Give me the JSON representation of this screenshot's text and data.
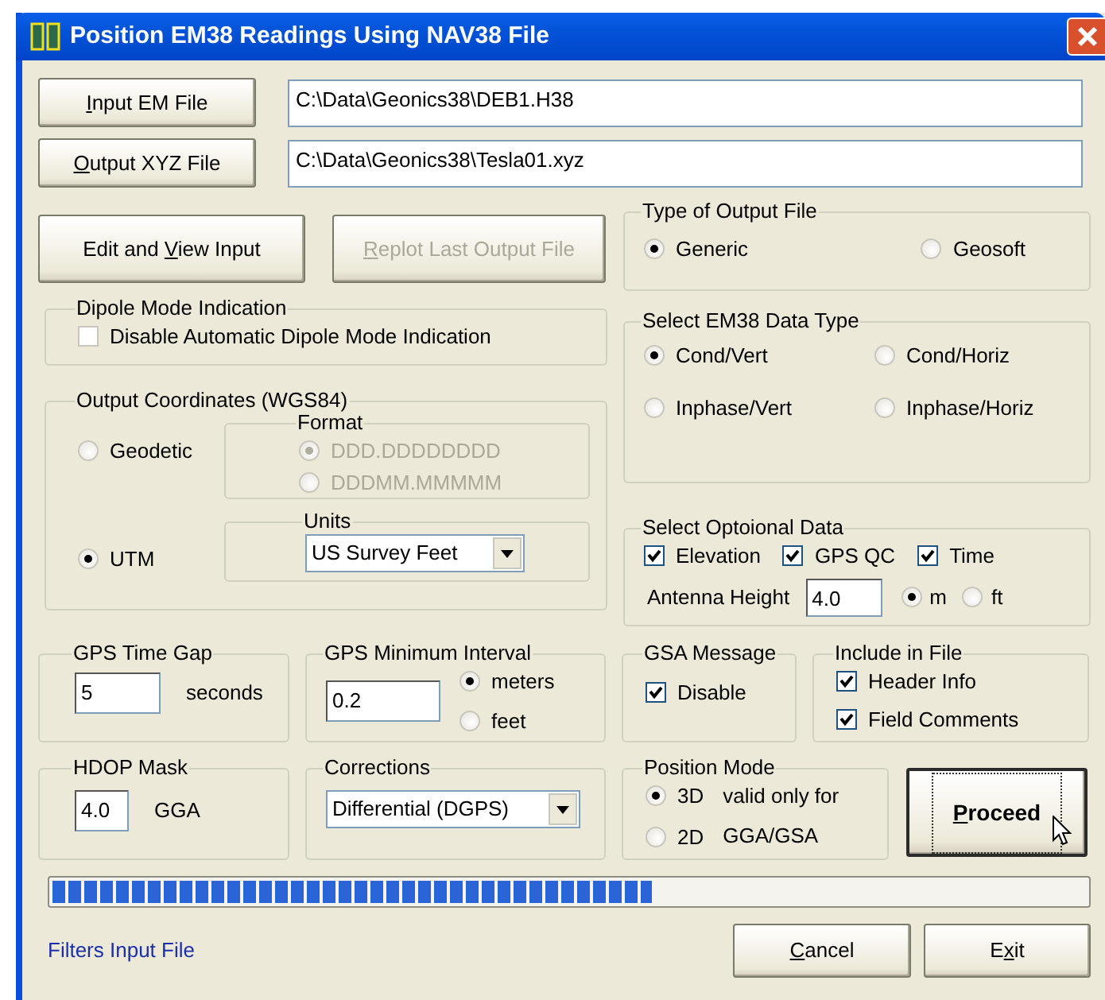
{
  "window": {
    "title": "Position EM38 Readings Using NAV38 File"
  },
  "file_rows": [
    {
      "button": {
        "key": "I",
        "after": "nput EM File"
      },
      "value": "C:\\Data\\Geonics38\\DEB1.H38"
    },
    {
      "button": {
        "key": "O",
        "after": "utput XYZ File"
      },
      "value": "C:\\Data\\Geonics38\\Tesla01.xyz"
    }
  ],
  "action_buttons": [
    {
      "before": "Edit and ",
      "key": "V",
      "after": "iew Input",
      "disabled": false
    },
    {
      "key": "R",
      "after": "eplot Last Output File",
      "disabled": true
    }
  ],
  "output_file_type": {
    "title": "Type of Output File",
    "options": [
      {
        "label": "Generic",
        "selected": true
      },
      {
        "label": "Geosoft",
        "selected": false
      }
    ]
  },
  "dipole_mode": {
    "title": "Dipole Mode Indication",
    "checkbox": {
      "label": "Disable Automatic Dipole Mode Indication",
      "checked": false
    }
  },
  "output_coordinates": {
    "title": "Output Coordinates (WGS84)",
    "systems": [
      {
        "label": "Geodetic",
        "selected": false
      },
      {
        "label": "UTM",
        "selected": true
      }
    ],
    "format": {
      "title": "Format",
      "disabled": true,
      "options": [
        {
          "label": "DDD.DDDDDDDD",
          "selected": true
        },
        {
          "label": "DDDMM.MMMMM",
          "selected": false
        }
      ]
    },
    "units": {
      "title": "Units",
      "value": "US Survey Feet"
    }
  },
  "em38_data_type": {
    "title": "Select EM38 Data Type",
    "options": [
      {
        "label": "Cond/Vert",
        "selected": true
      },
      {
        "label": "Cond/Horiz",
        "selected": false
      },
      {
        "label": "Inphase/Vert",
        "selected": false
      },
      {
        "label": "Inphase/Horiz",
        "selected": false
      }
    ]
  },
  "optional_data": {
    "title": "Select Optoional Data",
    "checkboxes": [
      {
        "label": "Elevation",
        "checked": true
      },
      {
        "label": "GPS QC",
        "checked": true
      },
      {
        "label": "Time",
        "checked": true
      }
    ],
    "antenna_height": {
      "label": "Antenna Height",
      "value": "4.0",
      "units": [
        {
          "label": "m",
          "selected": true
        },
        {
          "label": "ft",
          "selected": false
        }
      ]
    }
  },
  "gps_time_gap": {
    "title": "GPS Time Gap",
    "value": "5",
    "unit": "seconds"
  },
  "gps_min_interval": {
    "title": "GPS Minimum Interval",
    "value": "0.2",
    "units": [
      {
        "label": "meters",
        "selected": true
      },
      {
        "label": "feet",
        "selected": false
      }
    ]
  },
  "gsa_message": {
    "title": "GSA Message",
    "checkbox": {
      "label": "Disable",
      "checked": true
    }
  },
  "include_in_file": {
    "title": "Include in File",
    "checkboxes": [
      {
        "label": "Header Info",
        "checked": true
      },
      {
        "label": "Field Comments",
        "checked": true
      }
    ]
  },
  "hdop_mask": {
    "title": "HDOP Mask",
    "value": "4.0",
    "unit": "GGA"
  },
  "corrections": {
    "title": "Corrections",
    "value": "Differential (DGPS)"
  },
  "position_mode": {
    "title": "Position Mode",
    "options": [
      {
        "label": "3D",
        "selected": true
      },
      {
        "label": "2D",
        "selected": false
      }
    ],
    "note_lines": [
      "valid only for",
      "GGA/GSA"
    ]
  },
  "proceed_button": {
    "key": "P",
    "after": "roceed",
    "focused": true
  },
  "progress": {
    "level": 0.58
  },
  "status_text": "Filters Input File",
  "bottom_buttons": [
    {
      "key": "C",
      "after": "ancel"
    },
    {
      "before": "E",
      "key": "x",
      "after": "it"
    }
  ]
}
